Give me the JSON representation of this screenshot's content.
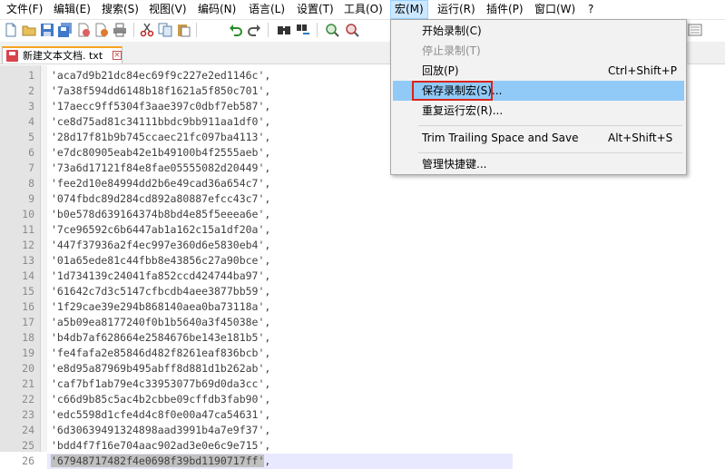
{
  "menubar": {
    "items": [
      "文件(F)",
      "编辑(E)",
      "搜索(S)",
      "视图(V)",
      "编码(N)",
      "语言(L)",
      "设置(T)",
      "工具(O)",
      "宏(M)",
      "运行(R)",
      "插件(P)",
      "窗口(W)",
      "?"
    ],
    "active_index": 8
  },
  "toolbar": {
    "icons": [
      "new-file-icon",
      "open-file-icon",
      "save-icon",
      "save-all-icon",
      "close-icon",
      "close-all-icon",
      "print-icon",
      "cut-icon",
      "copy-icon",
      "paste-icon",
      "undo-icon",
      "redo-icon",
      "find-icon",
      "replace-icon",
      "zoom-in-icon",
      "zoom-out-icon",
      "sync-scroll-icon"
    ]
  },
  "tab": {
    "label": "新建文本文档. txt",
    "close": "×"
  },
  "editor": {
    "lines": [
      "'aca7d9b21dc84ec69f9c227e2ed1146c',",
      "'7a38f594dd6148b18f1621a5f850c701',",
      "'17aecc9ff5304f3aae397c0dbf7eb587',",
      "'ce8d75ad81c34111bbdc9bb911aa1df0',",
      "'28d17f81b9b745ccaec21fc097ba4113',",
      "'e7dc80905eab42e1b49100b4f2555aeb',",
      "'73a6d17121f84e8fae05555082d20449',",
      "'fee2d10e84994dd2b6e49cad36a654c7',",
      "'074fbdc89d284cd892a80887efcc43c7',",
      "'b0e578d639164374b8bd4e85f5eeea6e',",
      "'7ce96592c6b6447ab1a162c15a1df20a',",
      "'447f37936a2f4ec997e360d6e5830eb4',",
      "'01a65ede81c44fbb8e43856c27a90bce',",
      "'1d734139c24041fa852ccd424744ba97',",
      "'61642c7d3c5147cfbcdb4aee3877bb59',",
      "'1f29cae39e294b868140aea0ba73118a',",
      "'a5b09ea8177240f0b1b5640a3f45038e',",
      "'b4db7af628664e2584676be143e181b5',",
      "'fe4fafa2e85846d482f8261eaf836bcb',",
      "'e8d95a87969b495abff8d881d1b262ab',",
      "'caf7bf1ab79e4c33953077b69d0da3cc',",
      "'c66d9b85c5ac4b2cbbe09cffdb3fab90',",
      "'edc5598d1cfe4d4c8f0e00a47ca54631',",
      "'6d30639491324898aad3991b4a7e9f37',",
      "'bdd4f7f16e704aac902ad3e0e6c9e715',"
    ],
    "last_line_selected": "'67948717482f4e0698f39bd1190717ff'",
    "last_line_tail": ","
  },
  "macro_menu": {
    "items": [
      {
        "label": "开始录制(C)",
        "shortcut": "",
        "state": "normal"
      },
      {
        "label": "停止录制(T)",
        "shortcut": "",
        "state": "disabled"
      },
      {
        "label": "回放(P)",
        "shortcut": "Ctrl+Shift+P",
        "state": "normal"
      },
      {
        "label": "保存录制宏(S)...",
        "shortcut": "",
        "state": "highlighted"
      },
      {
        "label": "重复运行宏(R)...",
        "shortcut": "",
        "state": "normal"
      },
      {
        "label": "Trim Trailing Space and Save",
        "shortcut": "Alt+Shift+S",
        "state": "normal"
      },
      {
        "label": "管理快捷键...",
        "shortcut": "",
        "state": "normal"
      }
    ]
  },
  "colors": {
    "highlight": "#91c9f7",
    "annotation": "#d9241c",
    "tab_accent": "#f7a521"
  }
}
